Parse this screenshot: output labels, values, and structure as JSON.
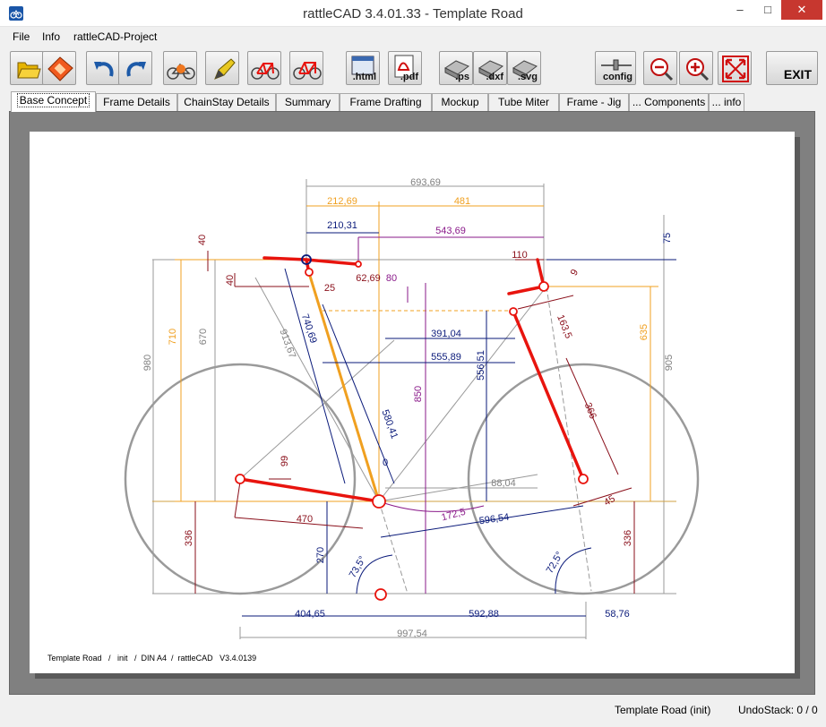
{
  "window": {
    "title": "rattleCAD  3.4.01.33 - Template Road",
    "minimize": "–",
    "maximize": "□",
    "close": "✕"
  },
  "menu": [
    "File",
    "Info",
    "rattleCAD-Project"
  ],
  "toolbar": {
    "buttons": [
      {
        "icon": "open-folder-icon"
      },
      {
        "icon": "save-icon"
      },
      {
        "icon": "undo-icon"
      },
      {
        "icon": "redo-icon"
      },
      {
        "icon": "bike-settings-icon"
      },
      {
        "icon": "bike-pencil-icon"
      },
      {
        "icon": "bike-red-icon"
      },
      {
        "icon": "bike-red-alt-icon"
      },
      {
        "icon": "export-html-icon",
        "label": ".html"
      },
      {
        "icon": "export-pdf-icon",
        "label": ".pdf"
      },
      {
        "icon": "export-ps-icon",
        "label": ".ps"
      },
      {
        "icon": "export-dxf-icon",
        "label": ".dxf"
      },
      {
        "icon": "export-svg-icon",
        "label": ".svg"
      },
      {
        "icon": "config-icon",
        "label": "config"
      },
      {
        "icon": "zoom-out-icon"
      },
      {
        "icon": "zoom-in-icon"
      },
      {
        "icon": "fit-screen-icon"
      }
    ],
    "exit_label": "EXIT"
  },
  "tabs": [
    "Base Concept",
    "Frame Details",
    "ChainStay Details",
    "Summary",
    "Frame Drafting",
    "Mockup",
    "Tube Miter",
    "Frame - Jig",
    "... Components",
    "... info"
  ],
  "drawing": {
    "footnote": "Template Road   /   init   /  DIN A4  /  rattleCAD   V3.4.0139",
    "dims_gray": [
      "693,69",
      "980",
      "670",
      "913,67",
      "905",
      "88,04",
      "997,54"
    ],
    "dims_orange": [
      "212,69",
      "481",
      "710",
      "635"
    ],
    "dims_purple": [
      "543,69",
      "80",
      "850",
      "172,5"
    ],
    "dims_navy": [
      "210,31",
      "740,69",
      "391,04",
      "555,89",
      "556,51",
      "580,41",
      "0",
      "596,54",
      "270",
      "73,5°",
      "72,5°",
      "404,65",
      "592,88",
      "58,76",
      "75"
    ],
    "dims_darkred": [
      "40",
      "40",
      "25",
      "62,69",
      "110",
      "9",
      "163,5",
      "366",
      "99",
      "470",
      "336",
      "336",
      "45"
    ]
  },
  "status": {
    "project": "Template Road (init)",
    "undo": "UndoStack:  0 / 0"
  },
  "colors": {
    "frame_red": "#e8140e",
    "dim_orange": "#f0a020",
    "dim_purple": "#8a1a8a",
    "dim_navy": "#0a1a7a",
    "dim_darkred": "#8a0f1a",
    "wheel_gray": "#9a9a9a"
  }
}
